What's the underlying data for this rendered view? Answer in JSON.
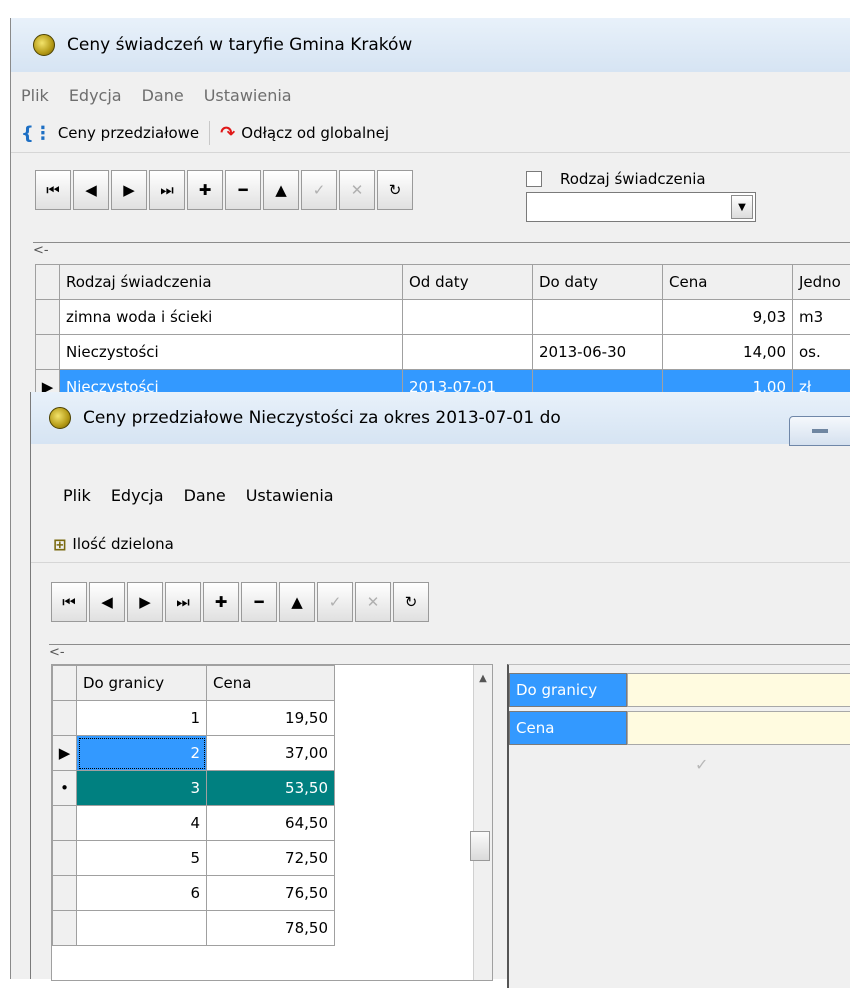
{
  "main_window": {
    "title": "Ceny świadczeń w taryfie Gmina Kraków",
    "menu": [
      "Plik",
      "Edycja",
      "Dane",
      "Ustawienia"
    ],
    "toolbar": {
      "intervals_label": "Ceny przedziałowe",
      "detach_label": "Odłącz od globalnej"
    },
    "nav_buttons": [
      "⏮",
      "◀",
      "▶",
      "⏭",
      "✚",
      "━",
      "▲",
      "✓",
      "✕",
      "↻"
    ],
    "filter": {
      "checkbox_label": "Rodzaj świadczenia",
      "combo_value": ""
    },
    "grip": "<-",
    "grid": {
      "headers": [
        "Rodzaj świadczenia",
        "Od daty",
        "Do daty",
        "Cena",
        "Jedno"
      ],
      "rows": [
        {
          "indicator": "",
          "rodzaj": "zimna woda i ścieki",
          "od": "",
          "do": "",
          "cena": "9,03",
          "jedn": "m3"
        },
        {
          "indicator": "",
          "rodzaj": "Nieczystości",
          "od": "",
          "do": "2013-06-30",
          "cena": "14,00",
          "jedn": "os."
        },
        {
          "indicator": "▶",
          "rodzaj": "Nieczystości",
          "od": "2013-07-01",
          "do": "",
          "cena": "1,00",
          "jedn": "zł"
        }
      ]
    }
  },
  "sub_window": {
    "title": "Ceny przedziałowe Nieczystości za okres 2013-07-01 do",
    "menu": [
      "Plik",
      "Edycja",
      "Dane",
      "Ustawienia"
    ],
    "toolbar": {
      "split_label": "Ilość dzielona"
    },
    "grip": "<-",
    "grid": {
      "headers": [
        "Do granicy",
        "Cena"
      ],
      "rows": [
        {
          "indicator": "",
          "granica": "1",
          "cena": "19,50"
        },
        {
          "indicator": "▶",
          "granica": "2",
          "cena": "37,00"
        },
        {
          "indicator": "•",
          "granica": "3",
          "cena": "53,50"
        },
        {
          "indicator": "",
          "granica": "4",
          "cena": "64,50"
        },
        {
          "indicator": "",
          "granica": "5",
          "cena": "72,50"
        },
        {
          "indicator": "",
          "granica": "6",
          "cena": "76,50"
        },
        {
          "indicator": "",
          "granica": "",
          "cena": "78,50"
        }
      ]
    },
    "fields": {
      "granica_label": "Do granicy",
      "cena_label": "Cena",
      "pen_glyph": "✓"
    }
  },
  "colors": {
    "selection": "#3399ff",
    "highlight_row": "#008080",
    "field_bg": "#fffbe0"
  }
}
